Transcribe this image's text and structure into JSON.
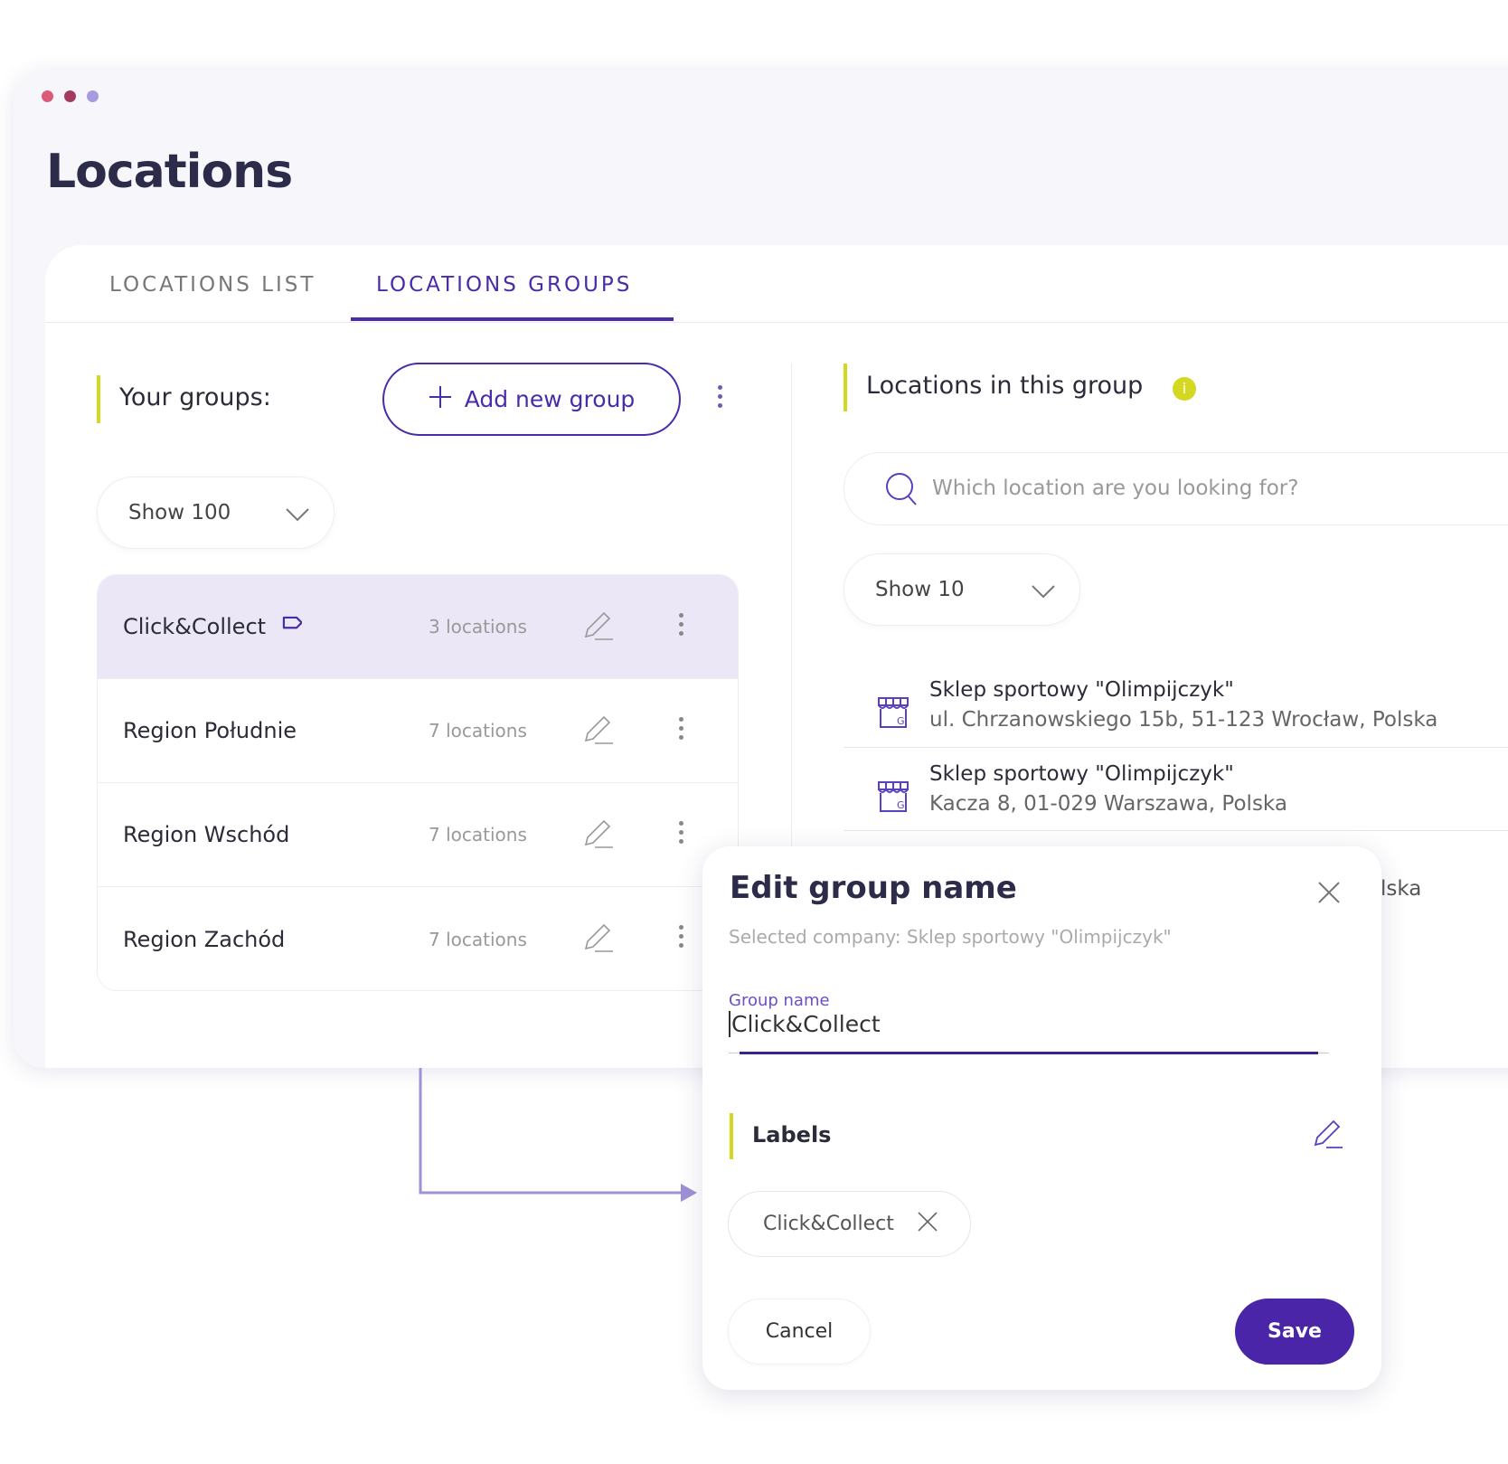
{
  "colors": {
    "accent": "#4a2ca8",
    "highlight": "#d4d821",
    "selected_row": "#ebe7f7",
    "save_button": "#4a25a8"
  },
  "window": {
    "dots": [
      "#dc5a78",
      "#a43a5c",
      "#a79be0"
    ]
  },
  "page": {
    "title": "Locations"
  },
  "tabs": [
    {
      "label": "LOCATIONS LIST",
      "active": false
    },
    {
      "label": "LOCATIONS GROUPS",
      "active": true
    }
  ],
  "groups_panel": {
    "title": "Your groups:",
    "add_button": "Add new group",
    "show_select": "Show 100",
    "groups": [
      {
        "name": "Click&Collect",
        "count": "3 locations",
        "selected": true,
        "has_label_icon": true
      },
      {
        "name": "Region Południe",
        "count": "7 locations",
        "selected": false
      },
      {
        "name": "Region Wschód",
        "count": "7 locations",
        "selected": false
      },
      {
        "name": "Region Zachód",
        "count": "7 locations",
        "selected": false
      }
    ]
  },
  "locations_panel": {
    "title": "Locations in this group",
    "search_placeholder": "Which location are you looking for?",
    "show_select": "Show 10",
    "locations": [
      {
        "name": "Sklep sportowy \"Olimpijczyk\"",
        "address": "ul. Chrzanowskiego 15b, 51-123 Wrocław, Polska"
      },
      {
        "name": "Sklep sportowy \"Olimpijczyk\"",
        "address": "Kacza 8, 01-029 Warszawa, Polska"
      }
    ],
    "partial_text": "lska"
  },
  "modal": {
    "title": "Edit group name",
    "subtitle": "Selected company: Sklep sportowy \"Olimpijczyk\"",
    "field_label": "Group name",
    "field_value": "Click&Collect",
    "labels_title": "Labels",
    "chips": [
      "Click&Collect"
    ],
    "cancel": "Cancel",
    "save": "Save"
  }
}
